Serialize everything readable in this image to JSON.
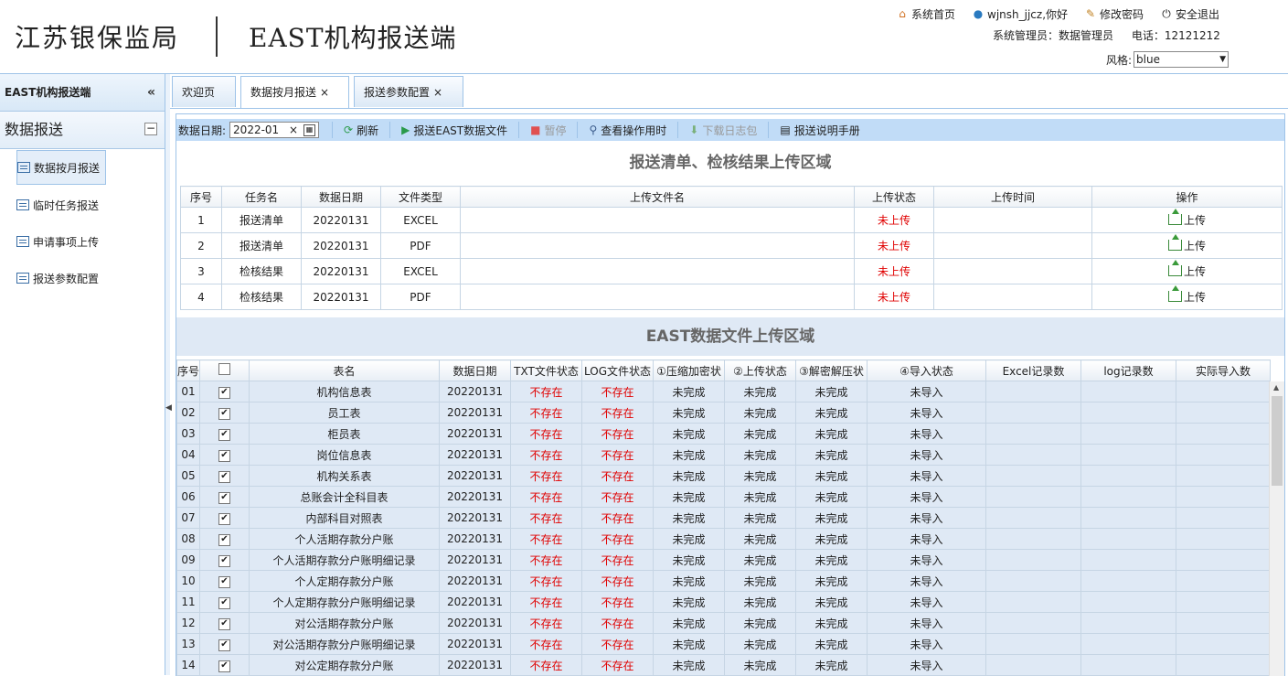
{
  "header": {
    "logo_text": "江苏银保监局",
    "system_name": "EAST机构报送端",
    "links": [
      {
        "icon": "home-icon",
        "label": "系统首页"
      },
      {
        "icon": "user-icon",
        "label": "wjnsh_jjcz,你好"
      },
      {
        "icon": "edit-icon",
        "label": "修改密码"
      },
      {
        "icon": "power-icon",
        "label": "安全退出"
      }
    ],
    "admin_label": "系统管理员：数据管理员",
    "phone_label": "电话：12121212",
    "style_label": "风格:",
    "style_value": "blue"
  },
  "sidebar": {
    "title": "EAST机构报送端",
    "collapse_icon": "«",
    "group": "数据报送",
    "items": [
      {
        "label": "数据按月报送",
        "active": true
      },
      {
        "label": "临时任务报送"
      },
      {
        "label": "申请事项上传"
      },
      {
        "label": "报送参数配置"
      }
    ]
  },
  "tabs": [
    {
      "label": "欢迎页"
    },
    {
      "label": "数据按月报送",
      "close": "×"
    },
    {
      "label": "报送参数配置",
      "close": "×"
    }
  ],
  "toolbar": {
    "date_label": "数据日期:",
    "date_value": "2022-01",
    "refresh": "刷新",
    "send_east": "报送EAST数据文件",
    "pause": "暂停",
    "view_time": "查看操作用时",
    "download_log": "下载日志包",
    "manual": "报送说明手册"
  },
  "section1": {
    "title": "报送清单、检核结果上传区域",
    "headers": [
      "序号",
      "任务名",
      "数据日期",
      "文件类型",
      "上传文件名",
      "上传状态",
      "上传时间",
      "操作"
    ],
    "rows": [
      {
        "no": "1",
        "task": "报送清单",
        "date": "20220131",
        "type": "EXCEL",
        "file": "",
        "status": "未上传",
        "time": "",
        "action": "上传"
      },
      {
        "no": "2",
        "task": "报送清单",
        "date": "20220131",
        "type": "PDF",
        "file": "",
        "status": "未上传",
        "time": "",
        "action": "上传"
      },
      {
        "no": "3",
        "task": "检核结果",
        "date": "20220131",
        "type": "EXCEL",
        "file": "",
        "status": "未上传",
        "time": "",
        "action": "上传"
      },
      {
        "no": "4",
        "task": "检核结果",
        "date": "20220131",
        "type": "PDF",
        "file": "",
        "status": "未上传",
        "time": "",
        "action": "上传"
      }
    ]
  },
  "section2": {
    "title": "EAST数据文件上传区域",
    "headers": [
      "序号",
      "",
      "表名",
      "数据日期",
      "TXT文件状态",
      "LOG文件状态",
      "①压缩加密状",
      "②上传状态",
      "③解密解压状",
      "④导入状态",
      "Excel记录数",
      "log记录数",
      "实际导入数"
    ],
    "rows": [
      {
        "no": "01",
        "name": "机构信息表",
        "date": "20220131",
        "txt": "不存在",
        "log": "不存在",
        "s1": "未完成",
        "s2": "未完成",
        "s3": "未完成",
        "s4": "未导入"
      },
      {
        "no": "02",
        "name": "员工表",
        "date": "20220131",
        "txt": "不存在",
        "log": "不存在",
        "s1": "未完成",
        "s2": "未完成",
        "s3": "未完成",
        "s4": "未导入"
      },
      {
        "no": "03",
        "name": "柜员表",
        "date": "20220131",
        "txt": "不存在",
        "log": "不存在",
        "s1": "未完成",
        "s2": "未完成",
        "s3": "未完成",
        "s4": "未导入"
      },
      {
        "no": "04",
        "name": "岗位信息表",
        "date": "20220131",
        "txt": "不存在",
        "log": "不存在",
        "s1": "未完成",
        "s2": "未完成",
        "s3": "未完成",
        "s4": "未导入"
      },
      {
        "no": "05",
        "name": "机构关系表",
        "date": "20220131",
        "txt": "不存在",
        "log": "不存在",
        "s1": "未完成",
        "s2": "未完成",
        "s3": "未完成",
        "s4": "未导入"
      },
      {
        "no": "06",
        "name": "总账会计全科目表",
        "date": "20220131",
        "txt": "不存在",
        "log": "不存在",
        "s1": "未完成",
        "s2": "未完成",
        "s3": "未完成",
        "s4": "未导入"
      },
      {
        "no": "07",
        "name": "内部科目对照表",
        "date": "20220131",
        "txt": "不存在",
        "log": "不存在",
        "s1": "未完成",
        "s2": "未完成",
        "s3": "未完成",
        "s4": "未导入"
      },
      {
        "no": "08",
        "name": "个人活期存款分户账",
        "date": "20220131",
        "txt": "不存在",
        "log": "不存在",
        "s1": "未完成",
        "s2": "未完成",
        "s3": "未完成",
        "s4": "未导入"
      },
      {
        "no": "09",
        "name": "个人活期存款分户账明细记录",
        "date": "20220131",
        "txt": "不存在",
        "log": "不存在",
        "s1": "未完成",
        "s2": "未完成",
        "s3": "未完成",
        "s4": "未导入"
      },
      {
        "no": "10",
        "name": "个人定期存款分户账",
        "date": "20220131",
        "txt": "不存在",
        "log": "不存在",
        "s1": "未完成",
        "s2": "未完成",
        "s3": "未完成",
        "s4": "未导入"
      },
      {
        "no": "11",
        "name": "个人定期存款分户账明细记录",
        "date": "20220131",
        "txt": "不存在",
        "log": "不存在",
        "s1": "未完成",
        "s2": "未完成",
        "s3": "未完成",
        "s4": "未导入"
      },
      {
        "no": "12",
        "name": "对公活期存款分户账",
        "date": "20220131",
        "txt": "不存在",
        "log": "不存在",
        "s1": "未完成",
        "s2": "未完成",
        "s3": "未完成",
        "s4": "未导入"
      },
      {
        "no": "13",
        "name": "对公活期存款分户账明细记录",
        "date": "20220131",
        "txt": "不存在",
        "log": "不存在",
        "s1": "未完成",
        "s2": "未完成",
        "s3": "未完成",
        "s4": "未导入"
      },
      {
        "no": "14",
        "name": "对公定期存款分户账",
        "date": "20220131",
        "txt": "不存在",
        "log": "不存在",
        "s1": "未完成",
        "s2": "未完成",
        "s3": "未完成",
        "s4": "未导入"
      }
    ]
  }
}
